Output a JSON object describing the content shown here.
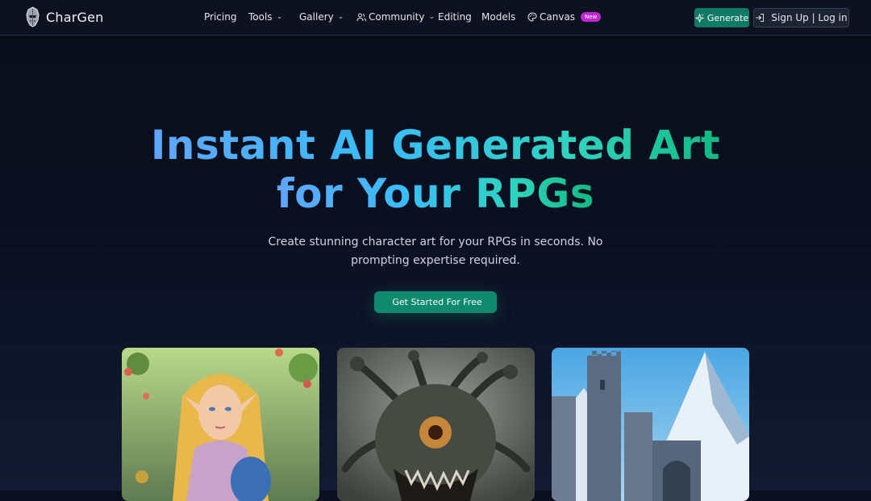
{
  "brand": {
    "name": "CharGen"
  },
  "nav": {
    "items": [
      {
        "label": "Pricing",
        "has_dropdown": false,
        "icon": null
      },
      {
        "label": "Tools",
        "has_dropdown": true,
        "icon": null
      },
      {
        "label": "Gallery",
        "has_dropdown": true,
        "icon": null
      },
      {
        "label": "Community",
        "has_dropdown": true,
        "icon": "users-icon"
      },
      {
        "label": "Editing",
        "has_dropdown": false,
        "icon": null
      },
      {
        "label": "Models",
        "has_dropdown": false,
        "icon": null
      },
      {
        "label": "Canvas",
        "has_dropdown": false,
        "icon": "palette-icon",
        "badge": "New"
      }
    ],
    "chevron_glyph": "⌄"
  },
  "actions": {
    "generate_label": "Generate",
    "login_label": "Sign Up | Log in"
  },
  "hero": {
    "title_line1": "Instant AI Generated Art",
    "title_line2": "for Your RPGs",
    "subtitle": "Create stunning character art for your RPGs in seconds. No prompting expertise required.",
    "cta_icon_glyph": "",
    "cta_label": "Get Started For Free"
  },
  "colors": {
    "background": "#0b1020",
    "accent_green": "#0f8a6e",
    "gradient_start": "#60a5fa",
    "gradient_end": "#10b981",
    "badge": "#c026d3"
  },
  "gallery": {
    "cards": [
      {
        "name": "elf-warrior-image"
      },
      {
        "name": "beholder-monster-image"
      },
      {
        "name": "mountain-castle-image"
      }
    ]
  }
}
